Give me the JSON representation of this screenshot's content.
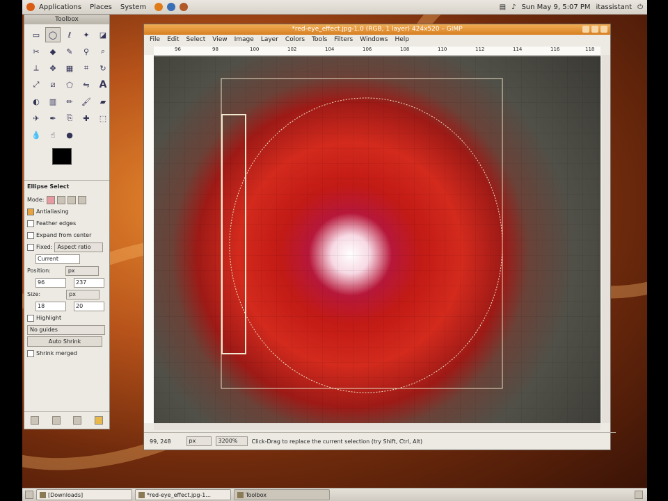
{
  "top_panel": {
    "menus": [
      "Applications",
      "Places",
      "System"
    ],
    "clock": "Sun May  9,  5:07 PM",
    "user": "itassistant"
  },
  "toolbox": {
    "title": "Toolbox",
    "tool_options_title": "Ellipse Select",
    "mode_label": "Mode:",
    "antialiasing": "Antialiasing",
    "feather_edges": "Feather edges",
    "expand_from_center": "Expand from center",
    "fixed_label": "Fixed:",
    "fixed_value": "Aspect ratio",
    "current": "Current",
    "position_label": "Position:",
    "position_unit": "px",
    "pos_x": "96",
    "pos_y": "237",
    "size_label": "Size:",
    "size_unit": "px",
    "size_w": "18",
    "size_h": "20",
    "highlight": "Highlight",
    "guides": "No guides",
    "auto_shrink": "Auto Shrink",
    "shrink_merged": "Shrink merged"
  },
  "image_window": {
    "title": "*red-eye_effect.jpg-1.0 (RGB, 1 layer) 424x520 – GIMP",
    "menus": [
      "File",
      "Edit",
      "Select",
      "View",
      "Image",
      "Layer",
      "Colors",
      "Tools",
      "Filters",
      "Windows",
      "Help"
    ],
    "ruler_ticks": [
      "96",
      "98",
      "100",
      "102",
      "104",
      "106",
      "108",
      "110",
      "112",
      "114",
      "116",
      "118"
    ],
    "status_coords": "99, 248",
    "status_unit": "px",
    "zoom": "3200%",
    "status_message": "Click-Drag to replace the current selection (try Shift, Ctrl, Alt)"
  },
  "taskbar": {
    "items": [
      "[Downloads]",
      "*red-eye_effect.jpg-1...",
      "Toolbox"
    ]
  }
}
